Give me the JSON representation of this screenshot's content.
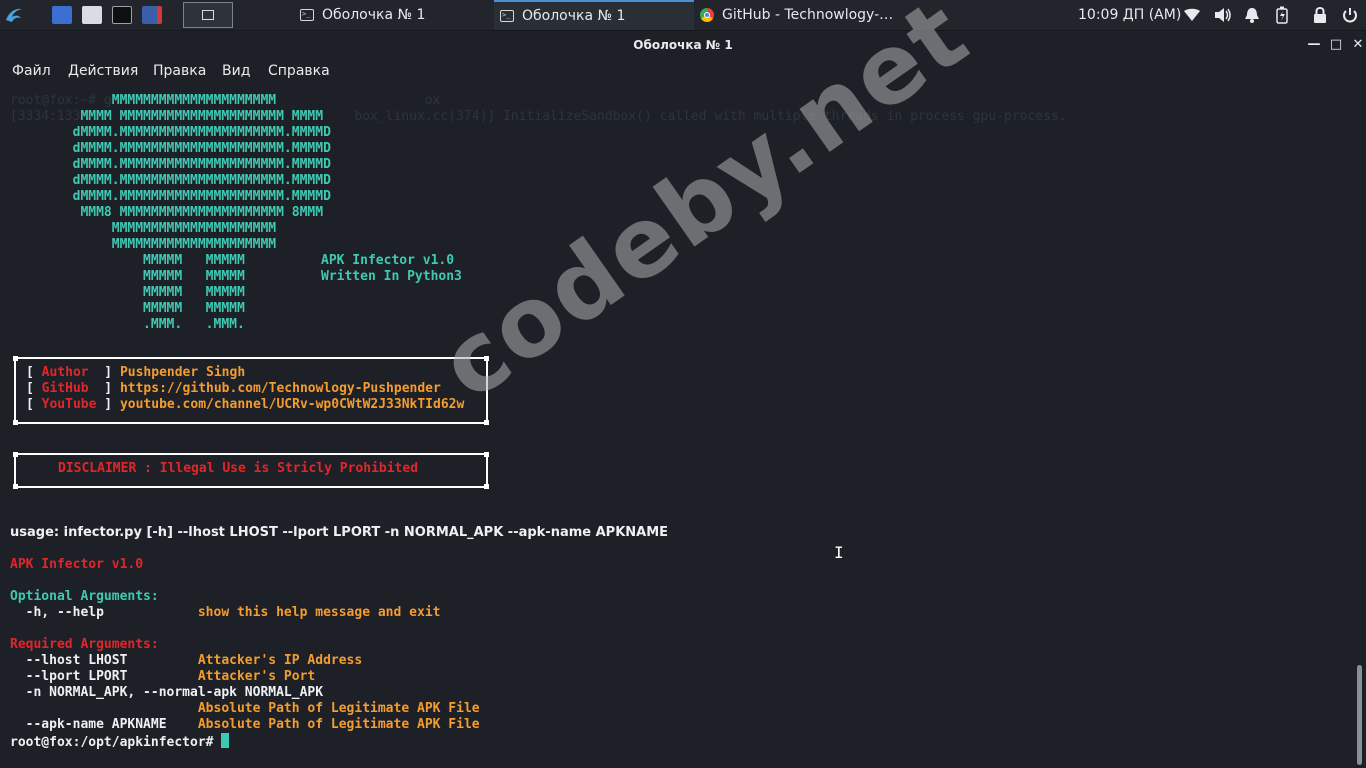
{
  "taskbar": {
    "tasks": [
      {
        "label": "Оболочка № 1",
        "active": false
      },
      {
        "label": "Оболочка № 1",
        "active": true
      },
      {
        "label": "GitHub - Technowlogy-…",
        "active": false
      }
    ],
    "clock": "10:09 ДП (AM)"
  },
  "window": {
    "title": "Оболочка № 1",
    "controls": {
      "minimize": "—",
      "maximize": "□",
      "close": "✕"
    }
  },
  "menu": [
    "Файл",
    "Действия",
    "Правка",
    "Вид",
    "Справка"
  ],
  "terminal": {
    "ghost": [
      "root@fox:~# g                                        ox",
      "[3334:133                                   box_linux.cc(374)] InitializeSandbox() called with multiple threads in process gpu-process."
    ],
    "ascii_art": [
      "             MMMMMMMMMMMMMMMMMMMMM",
      "         MMMM MMMMMMMMMMMMMMMMMMMMM MMMM",
      "        dMMMM.MMMMMMMMMMMMMMMMMMMMM.MMMMD",
      "        dMMMM.MMMMMMMMMMMMMMMMMMMMM.MMMMD",
      "        dMMMM.MMMMMMMMMMMMMMMMMMMMM.MMMMD",
      "        dMMMM.MMMMMMMMMMMMMMMMMMMMM.MMMMD",
      "        dMMMM.MMMMMMMMMMMMMMMMMMMMM.MMMMD",
      "         MMM8 MMMMMMMMMMMMMMMMMMMMM 8MMM",
      "             MMMMMMMMMMMMMMMMMMMMM",
      "             MMMMMMMMMMMMMMMMMMMMM",
      "                 MMMMM   MMMMM",
      "                 MMMMM   MMMMM",
      "                 MMMMM   MMMMM",
      "                 MMMMM   MMMMM",
      "                 .MMM.   .MMM."
    ],
    "banner_title": "APK Infector v1.0",
    "banner_subtitle": "Written In Python3",
    "info": [
      {
        "key": "Author ",
        "value": "Pushpender Singh"
      },
      {
        "key": "GitHub ",
        "value": "https://github.com/Technowlogy-Pushpender"
      },
      {
        "key": "YouTube",
        "value": "youtube.com/channel/UCRv-wp0CWtW2J33NkTId62w"
      }
    ],
    "disclaimer": "DISCLAIMER : Illegal Use is Stricly Prohibited",
    "usage": "usage: infector.py [-h] --lhost LHOST --lport LPORT -n NORMAL_APK --apk-name APKNAME",
    "version": "APK Infector v1.0",
    "optional_header": "Optional Arguments:",
    "optional": [
      {
        "flag": "  -h, --help            ",
        "desc": "show this help message and exit"
      }
    ],
    "required_header": "Required Arguments:",
    "required": [
      {
        "flag": "  --lhost LHOST         ",
        "desc": "Attacker's IP Address"
      },
      {
        "flag": "  --lport LPORT         ",
        "desc": "Attacker's Port"
      },
      {
        "flag": "  -n NORMAL_APK, --normal-apk NORMAL_APK",
        "desc": ""
      },
      {
        "flag": "                        ",
        "desc": "Absolute Path of Legitimate APK File"
      },
      {
        "flag": "  --apk-name APKNAME    ",
        "desc": "Absolute Path of Legitimate APK File"
      }
    ],
    "prompt": "root@fox:/opt/apkinfector# "
  },
  "watermark": "codeby.net"
}
